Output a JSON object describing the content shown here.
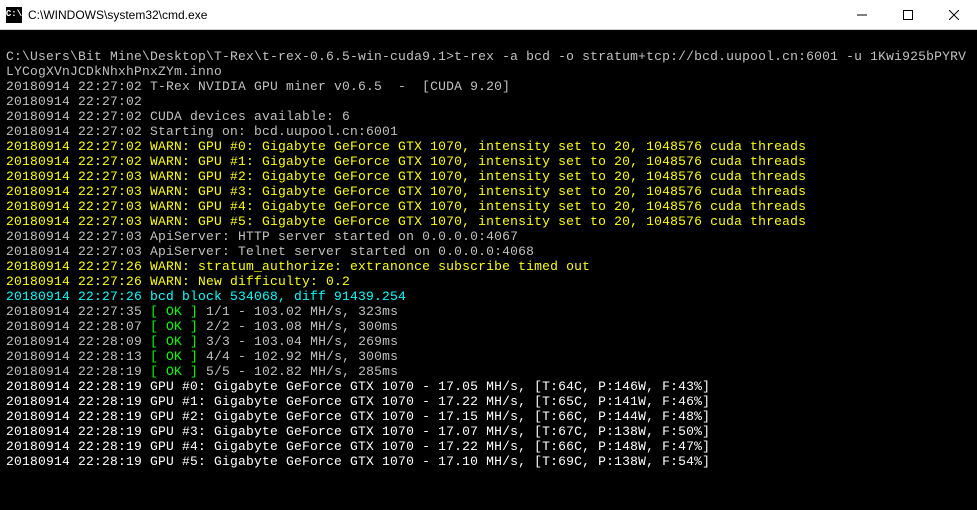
{
  "window": {
    "title": "C:\\WINDOWS\\system32\\cmd.exe",
    "icon_label": "C:\\"
  },
  "command": "C:\\Users\\Bit Mine\\Desktop\\T-Rex\\t-rex-0.6.5-win-cuda9.1>t-rex -a bcd -o stratum+tcp://bcd.uupool.cn:6001 -u 1Kwi925bPYRVLYCogXVnJCDkNhxhPnxZYm.inno",
  "info_lines": [
    "20180914 22:27:02 T-Rex NVIDIA GPU miner v0.6.5  -  [CUDA 9.20]",
    "20180914 22:27:02",
    "20180914 22:27:02 CUDA devices available: 6",
    "20180914 22:27:02 Starting on: bcd.uupool.cn:6001"
  ],
  "gpu_warn": [
    "20180914 22:27:02 WARN: GPU #0: Gigabyte GeForce GTX 1070, intensity set to 20, 1048576 cuda threads",
    "20180914 22:27:02 WARN: GPU #1: Gigabyte GeForce GTX 1070, intensity set to 20, 1048576 cuda threads",
    "20180914 22:27:03 WARN: GPU #2: Gigabyte GeForce GTX 1070, intensity set to 20, 1048576 cuda threads",
    "20180914 22:27:03 WARN: GPU #3: Gigabyte GeForce GTX 1070, intensity set to 20, 1048576 cuda threads",
    "20180914 22:27:03 WARN: GPU #4: Gigabyte GeForce GTX 1070, intensity set to 20, 1048576 cuda threads",
    "20180914 22:27:03 WARN: GPU #5: Gigabyte GeForce GTX 1070, intensity set to 20, 1048576 cuda threads"
  ],
  "api_lines": [
    "20180914 22:27:03 ApiServer: HTTP server started on 0.0.0.0:4067",
    "20180914 22:27:03 ApiServer: Telnet server started on 0.0.0.0:4068"
  ],
  "stratum_warn": [
    "20180914 22:27:26 WARN: stratum_authorize: extranonce subscribe timed out",
    "20180914 22:27:26 WARN: New difficulty: 0.2"
  ],
  "block_line": "20180914 22:27:26 bcd block 534068, diff 91439.254",
  "ok_rows": [
    {
      "pre": "20180914 22:27:35 ",
      "ok": "[ OK ]",
      "post": " 1/1 - 103.02 MH/s, 323ms"
    },
    {
      "pre": "20180914 22:28:07 ",
      "ok": "[ OK ]",
      "post": " 2/2 - 103.08 MH/s, 300ms"
    },
    {
      "pre": "20180914 22:28:09 ",
      "ok": "[ OK ]",
      "post": " 3/3 - 103.04 MH/s, 269ms"
    },
    {
      "pre": "20180914 22:28:13 ",
      "ok": "[ OK ]",
      "post": " 4/4 - 102.92 MH/s, 300ms"
    },
    {
      "pre": "20180914 22:28:19 ",
      "ok": "[ OK ]",
      "post": " 5/5 - 102.82 MH/s, 285ms"
    }
  ],
  "gpu_stats": [
    "20180914 22:28:19 GPU #0: Gigabyte GeForce GTX 1070 - 17.05 MH/s, [T:64C, P:146W, F:43%]",
    "20180914 22:28:19 GPU #1: Gigabyte GeForce GTX 1070 - 17.22 MH/s, [T:65C, P:141W, F:46%]",
    "20180914 22:28:19 GPU #2: Gigabyte GeForce GTX 1070 - 17.15 MH/s, [T:66C, P:144W, F:48%]",
    "20180914 22:28:19 GPU #3: Gigabyte GeForce GTX 1070 - 17.07 MH/s, [T:67C, P:138W, F:50%]",
    "20180914 22:28:19 GPU #4: Gigabyte GeForce GTX 1070 - 17.22 MH/s, [T:66C, P:148W, F:47%]",
    "20180914 22:28:19 GPU #5: Gigabyte GeForce GTX 1070 - 17.10 MH/s, [T:69C, P:138W, F:54%]"
  ]
}
